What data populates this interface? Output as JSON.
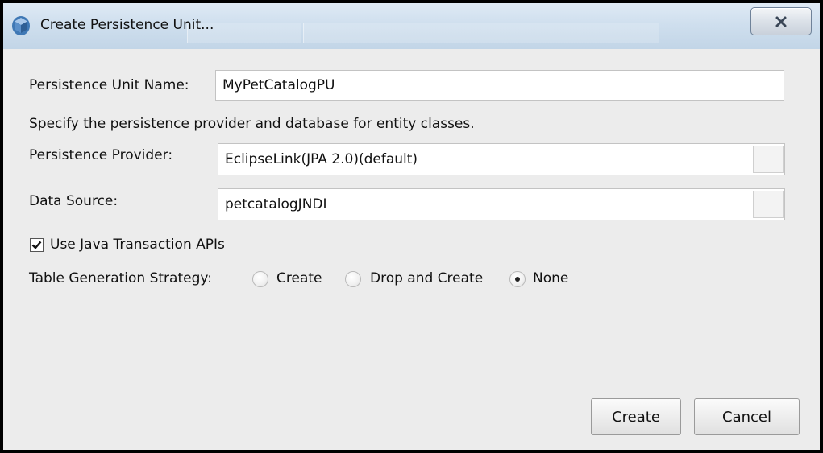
{
  "window": {
    "title": "Create Persistence Unit..."
  },
  "form": {
    "unit_name_label": "Persistence Unit Name:",
    "unit_name_value": "MyPetCatalogPU",
    "description": "Specify the persistence provider and database for entity classes.",
    "provider_label": "Persistence Provider:",
    "provider_value": "EclipseLink(JPA 2.0)(default)",
    "datasource_label": "Data Source:",
    "datasource_value": "petcatalogJNDI",
    "jta_label": "Use Java Transaction APIs",
    "jta_checked": true,
    "strategy_label": "Table Generation Strategy:",
    "strategy_options": [
      {
        "label": "Create",
        "selected": false
      },
      {
        "label": "Drop and Create",
        "selected": false
      },
      {
        "label": "None",
        "selected": true
      }
    ]
  },
  "buttons": {
    "create": "Create",
    "cancel": "Cancel"
  },
  "icons": {
    "window_icon": "cube-icon",
    "close": "close-icon"
  },
  "colors": {
    "titlebar": "#cfdfee",
    "dialog_bg": "#ececec",
    "border": "#000000"
  }
}
